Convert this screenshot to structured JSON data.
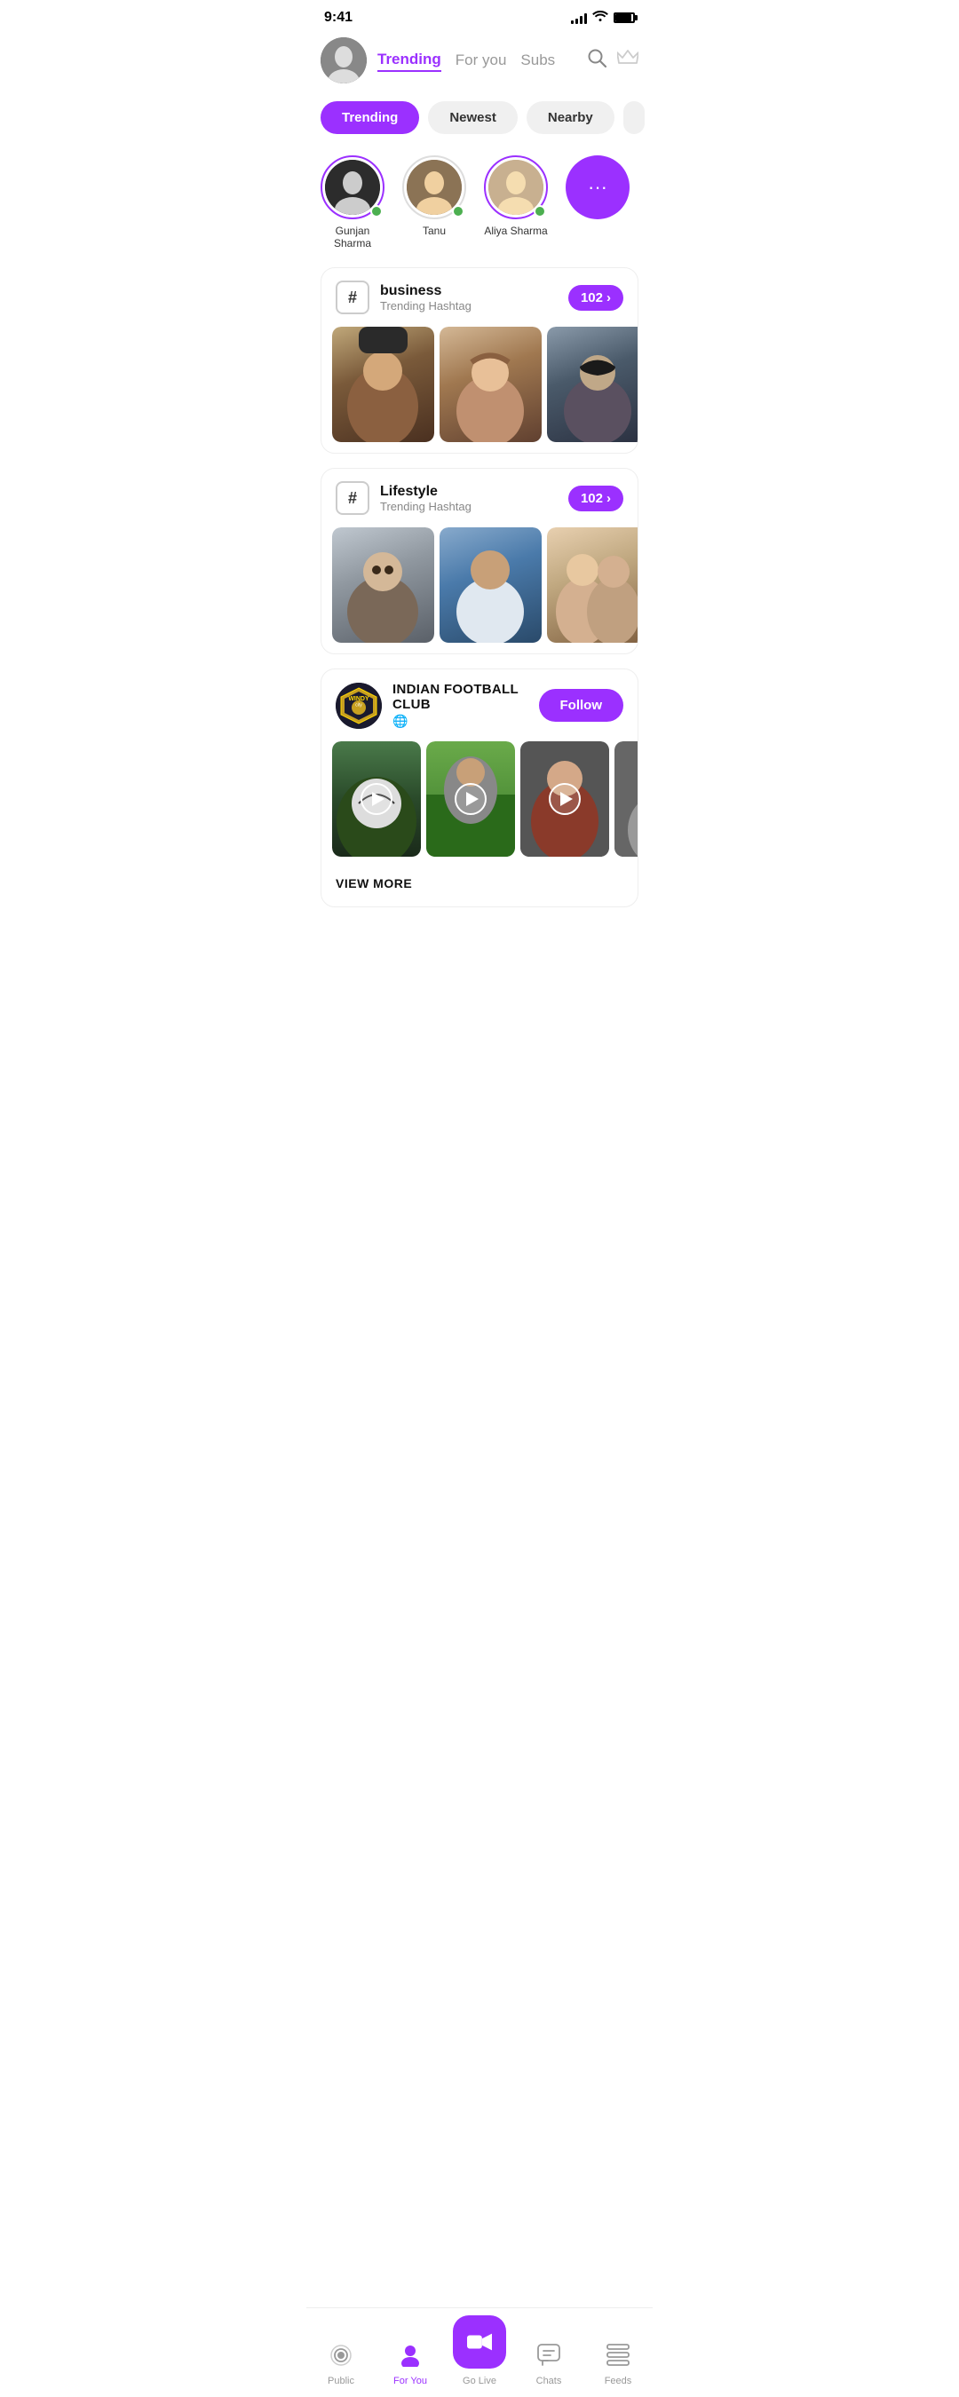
{
  "status": {
    "time": "9:41",
    "signal": [
      3,
      5,
      7,
      10,
      13
    ],
    "battery_level": 90
  },
  "header": {
    "tabs": [
      {
        "id": "trending",
        "label": "Trending",
        "active": true
      },
      {
        "id": "for_you",
        "label": "For you",
        "active": false
      },
      {
        "id": "subs",
        "label": "Subs",
        "active": false
      }
    ]
  },
  "filters": [
    {
      "id": "trending",
      "label": "Trending",
      "active": true
    },
    {
      "id": "newest",
      "label": "Newest",
      "active": false
    },
    {
      "id": "nearby",
      "label": "Nearby",
      "active": false
    }
  ],
  "stories": [
    {
      "id": "gunjan",
      "name": "Gunjan Sharma",
      "online": true,
      "has_ring": true
    },
    {
      "id": "tanu",
      "name": "Tanu",
      "online": true,
      "has_ring": false
    },
    {
      "id": "aliya",
      "name": "Aliya Sharma",
      "online": true,
      "has_ring": true
    }
  ],
  "hashtag_cards": [
    {
      "id": "business",
      "name": "business",
      "sub": "Trending Hashtag",
      "count": "102"
    },
    {
      "id": "lifestyle",
      "name": "Lifestyle",
      "sub": "Trending Hashtag",
      "count": "102"
    }
  ],
  "club": {
    "name": "INDIAN FOOTBALL CLUB",
    "type": "Public",
    "follow_label": "Follow",
    "view_more_label": "VIEW MORE"
  },
  "bottom_nav": [
    {
      "id": "public",
      "label": "Public",
      "active": false,
      "icon": "radio"
    },
    {
      "id": "for_you",
      "label": "For You",
      "active": true,
      "icon": "person"
    },
    {
      "id": "go_live",
      "label": "Go Live",
      "active": false,
      "icon": "camera"
    },
    {
      "id": "chats",
      "label": "Chats",
      "active": false,
      "icon": "chat"
    },
    {
      "id": "feeds",
      "label": "Feeds",
      "active": false,
      "icon": "feed"
    }
  ]
}
